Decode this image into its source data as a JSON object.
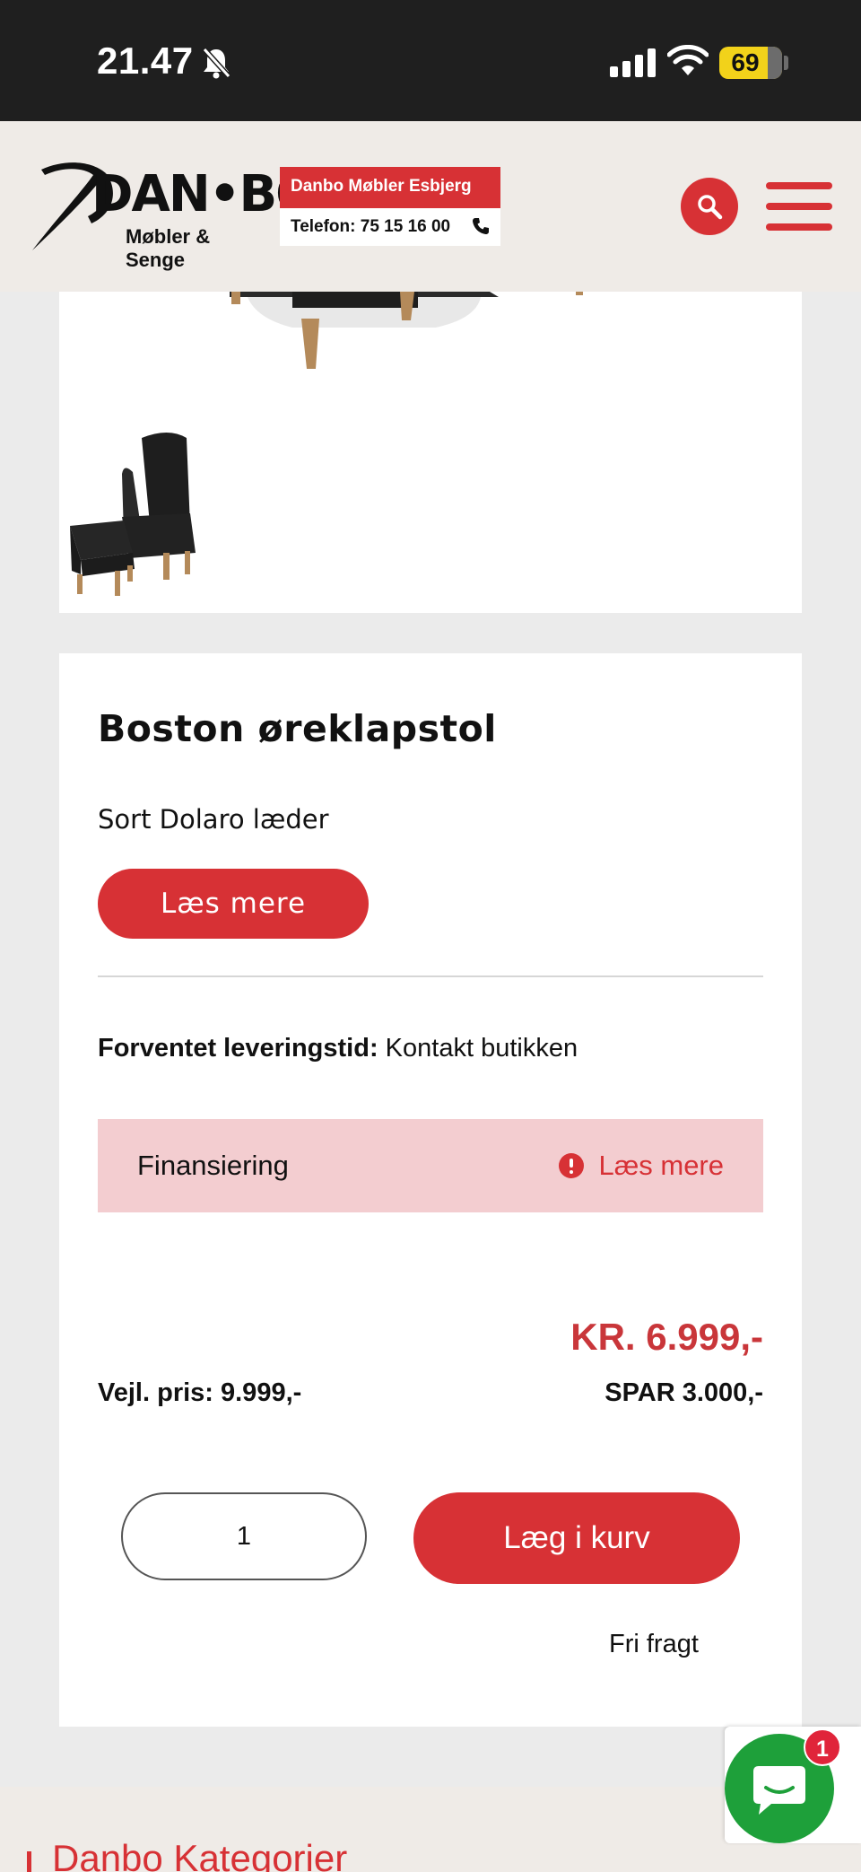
{
  "status_bar": {
    "time": "21.47",
    "battery": "69",
    "icons": [
      "bell-slash-icon",
      "cellular-signal-icon",
      "wifi-icon",
      "battery-icon"
    ]
  },
  "header": {
    "logo_text": "DAN•BO",
    "logo_subtitle": "Møbler & Senge",
    "store_name": "Danbo Møbler Esbjerg",
    "store_phone": "Telefon: 75 15 16 00",
    "icons": [
      "phone-icon",
      "search-icon",
      "hamburger-menu-icon"
    ]
  },
  "product": {
    "title": "Boston øreklapstol",
    "variant": "Sort Dolaro læder",
    "read_more_label": "Læs mere",
    "delivery_label": "Forventet leveringstid:",
    "delivery_value": " Kontakt butikken",
    "finance_label": "Finansiering",
    "finance_link": "Læs mere",
    "price": "KR. 6.999,-",
    "guide_price": "Vejl. pris: 9.999,-",
    "savings": "SPAR 3.000,-",
    "quantity": "1",
    "add_to_cart_label": "Læg i kurv",
    "shipping_note": "Fri fragt"
  },
  "footer": {
    "section_title": "Danbo Kategorier"
  },
  "chat": {
    "badge_count": "1",
    "icon": "chat-bubble-icon"
  },
  "colors": {
    "brand_red": "#d73135",
    "finance_bg": "#f3cdd0",
    "chat_green": "#1ea03a",
    "header_bg": "#efebe7"
  }
}
